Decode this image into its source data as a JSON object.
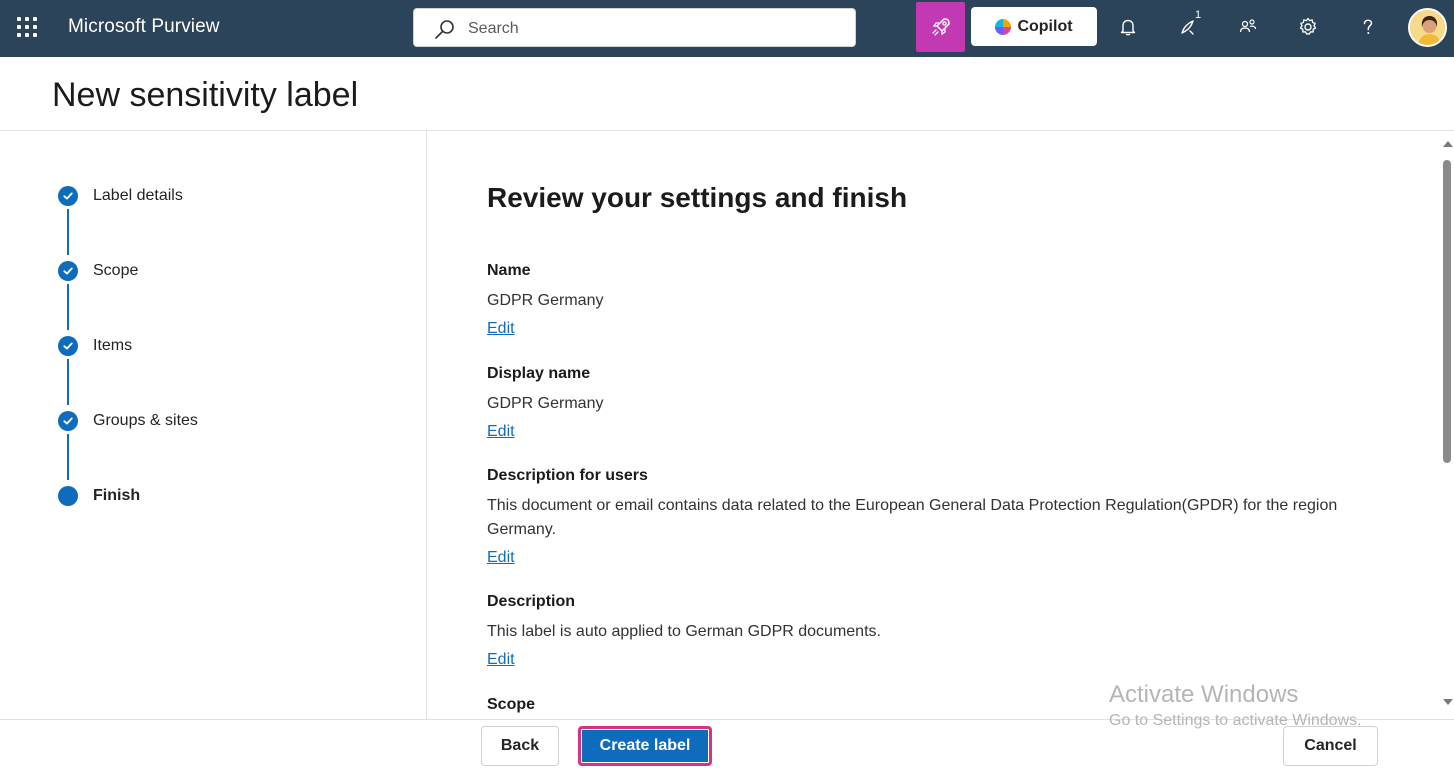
{
  "topbar": {
    "app_title": "Microsoft Purview",
    "search_placeholder": "Search",
    "copilot_label": "Copilot",
    "notification_count": "1"
  },
  "header": {
    "title": "New sensitivity label"
  },
  "steps": [
    {
      "label": "Label details",
      "status": "completed"
    },
    {
      "label": "Scope",
      "status": "completed"
    },
    {
      "label": "Items",
      "status": "completed"
    },
    {
      "label": "Groups & sites",
      "status": "completed"
    },
    {
      "label": "Finish",
      "status": "current"
    }
  ],
  "main": {
    "title": "Review your settings and finish",
    "sections": [
      {
        "heading": "Name",
        "value": "GDPR Germany",
        "edit": "Edit"
      },
      {
        "heading": "Display name",
        "value": "GDPR Germany",
        "edit": "Edit"
      },
      {
        "heading": "Description for users",
        "value": "This document or email contains data related to the European General Data Protection Regulation(GPDR) for the region Germany.",
        "edit": "Edit"
      },
      {
        "heading": "Description",
        "value": "This label is auto applied to German GDPR documents.",
        "edit": "Edit"
      },
      {
        "heading": "Scope"
      }
    ]
  },
  "footer": {
    "back_label": "Back",
    "create_label": "Create label",
    "cancel_label": "Cancel"
  },
  "watermark": {
    "line1": "Activate Windows",
    "line2": "Go to Settings to activate Windows."
  },
  "colors": {
    "topbar_bg": "#2c4459",
    "accent": "#0f6cbd",
    "rocket_bg": "#c239b3",
    "highlight_border": "#d63384"
  },
  "icons": [
    "app-launcher-icon",
    "search-icon",
    "rocket-icon",
    "copilot-icon",
    "bell-icon",
    "sparkle-icon",
    "people-icon",
    "gear-icon",
    "help-icon",
    "check-icon"
  ]
}
